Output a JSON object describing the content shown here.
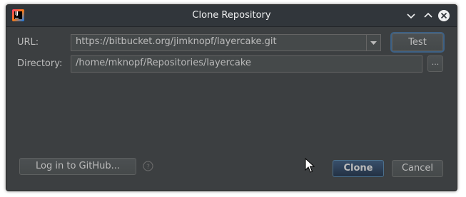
{
  "window": {
    "title": "Clone Repository",
    "app_icon": "intellij-idea-icon"
  },
  "titlebar_buttons": {
    "minimize_icon": "chevron-down-icon",
    "maximize_icon": "chevron-up-icon",
    "close_icon": "close-circle-icon"
  },
  "form": {
    "url_label": "URL:",
    "url_value": "https://bitbucket.org/jimknopf/layercake.git",
    "directory_label": "Directory:",
    "directory_value": "/home/mknopf/Repositories/layercake",
    "test_button": "Test",
    "browse_button": "..."
  },
  "footer": {
    "github_button": "Log in to GitHub...",
    "help_icon": "question-mark-icon",
    "clone_button": "Clone",
    "cancel_button": "Cancel"
  },
  "colors": {
    "background": "#3c3f41",
    "titlebar": "#31363b",
    "field_bg": "#45494a",
    "field_border": "#646464",
    "text": "#bbbbbb",
    "default_button": "#365880",
    "focus_ring": "#3d6185"
  }
}
